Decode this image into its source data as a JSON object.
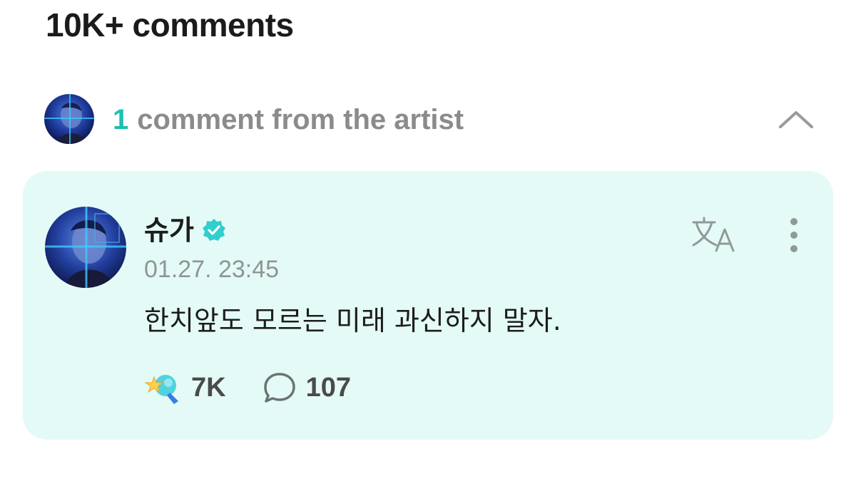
{
  "header": {
    "comments_title": "10K+ comments"
  },
  "artist_section": {
    "count": "1",
    "label": "comment from the artist",
    "collapse_icon": "chevron-up-icon"
  },
  "comment": {
    "author": "슈가",
    "verified_icon": "verified-badge-icon",
    "timestamp": "01.27. 23:45",
    "text": "한치앞도 모르는 미래 과신하지 말자.",
    "translate_icon": "translate-icon",
    "more_icon": "more-vertical-icon",
    "reactions": {
      "icon": "reaction-sticker-icon",
      "count": "7K"
    },
    "replies": {
      "icon": "chat-bubble-icon",
      "count": "107"
    }
  },
  "colors": {
    "accent": "#1fbfb0",
    "card_background": "#e4faf7",
    "muted_text": "#8b8b8b",
    "verified": "#2fcfcf"
  }
}
